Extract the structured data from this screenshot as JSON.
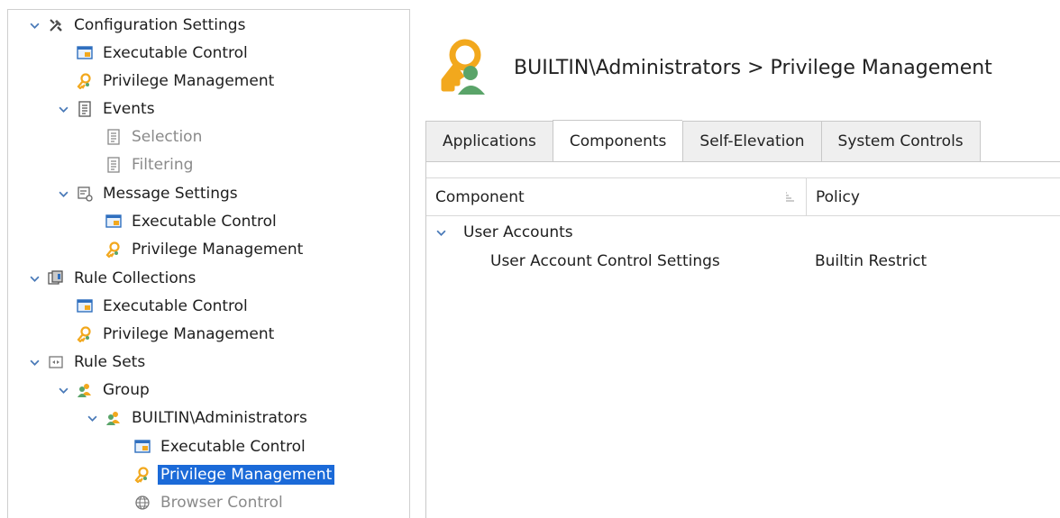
{
  "tree": {
    "items": [
      {
        "label": "Configuration Settings",
        "icon": "tools-icon",
        "expanded": true,
        "dim": false
      },
      {
        "label": "Executable Control",
        "icon": "executable-control-icon",
        "dim": false
      },
      {
        "label": "Privilege Management",
        "icon": "privilege-key-icon",
        "dim": false
      },
      {
        "label": "Events",
        "icon": "events-document-icon",
        "expanded": true,
        "dim": false
      },
      {
        "label": "Selection",
        "icon": "document-icon",
        "dim": true
      },
      {
        "label": "Filtering",
        "icon": "document-icon",
        "dim": true
      },
      {
        "label": "Message Settings",
        "icon": "message-settings-icon",
        "expanded": true,
        "dim": false
      },
      {
        "label": "Executable Control",
        "icon": "executable-control-icon",
        "dim": false
      },
      {
        "label": "Privilege Management",
        "icon": "privilege-key-icon",
        "dim": false
      },
      {
        "label": "Rule Collections",
        "icon": "rule-collections-icon",
        "expanded": true,
        "dim": false
      },
      {
        "label": "Executable Control",
        "icon": "executable-control-icon",
        "dim": false
      },
      {
        "label": "Privilege Management",
        "icon": "privilege-key-icon",
        "dim": false
      },
      {
        "label": "Rule Sets",
        "icon": "rule-sets-icon",
        "expanded": true,
        "dim": false
      },
      {
        "label": "Group",
        "icon": "group-icon",
        "expanded": true,
        "dim": false
      },
      {
        "label": "BUILTIN\\Administrators",
        "icon": "group-icon",
        "expanded": true,
        "dim": false
      },
      {
        "label": "Executable Control",
        "icon": "executable-control-icon",
        "dim": false
      },
      {
        "label": "Privilege Management",
        "icon": "privilege-key-icon",
        "dim": false,
        "selected": true
      },
      {
        "label": "Browser Control",
        "icon": "globe-icon",
        "dim": true
      }
    ]
  },
  "header": {
    "title": "BUILTIN\\Administrators > Privilege Management",
    "icon": "privilege-key-user-icon"
  },
  "tabs": [
    {
      "label": "Applications",
      "active": false
    },
    {
      "label": "Components",
      "active": true
    },
    {
      "label": "Self-Elevation",
      "active": false
    },
    {
      "label": "System Controls",
      "active": false
    }
  ],
  "grid": {
    "columns": [
      "Component",
      "Policy"
    ],
    "group": {
      "label": "User Accounts",
      "expanded": true
    },
    "rows": [
      {
        "component": "User Account Control Settings",
        "policy": "Builtin Restrict"
      }
    ]
  },
  "colors": {
    "accent": "#1b6ad8",
    "chevron": "#4a7ab8",
    "key": "#f2a81d",
    "dim_text": "#8a8a8a"
  }
}
